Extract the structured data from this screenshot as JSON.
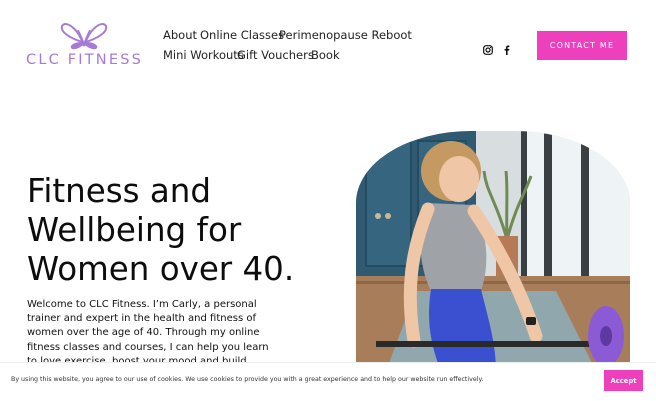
{
  "brand": {
    "logo_text": "CLC FITNESS",
    "accent_color": "#a77ad6"
  },
  "nav": {
    "items": [
      "About",
      "Online Classes",
      "Perimenopause Reboot",
      "Mini Workouts",
      "Gift Vouchers",
      "Book"
    ]
  },
  "social": {
    "icons": [
      "instagram-icon",
      "facebook-icon"
    ]
  },
  "cta": {
    "label": "CONTACT ME",
    "color": "#ee3fbd"
  },
  "hero": {
    "headline": "Fitness and Wellbeing for Women over 40.",
    "intro": "Welcome to CLC Fitness. I’m Carly, a personal trainer and expert in the health and fitness of women over the age of 40. Through my online fitness classes and courses, I can help you learn to love exercise, boost your mood and build"
  },
  "cookie_banner": {
    "text": "By using this website, you agree to our use of cookies. We use cookies to provide you with a great experience and to help our website run effectively.",
    "accept_label": "Accept"
  }
}
